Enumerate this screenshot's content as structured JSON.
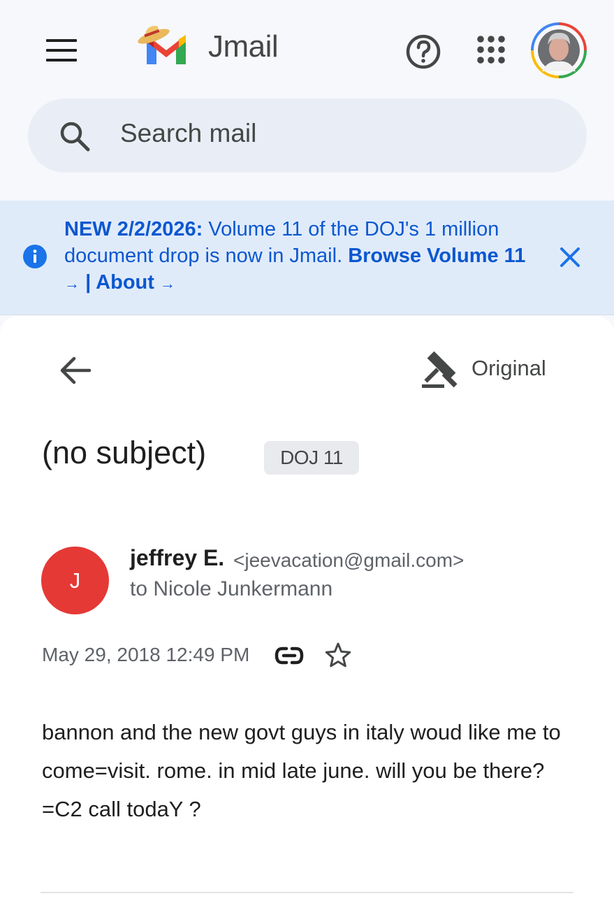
{
  "app": {
    "name": "Jmail"
  },
  "search": {
    "placeholder": "Search mail"
  },
  "banner": {
    "prefix": "NEW 2/2/2026:",
    "message": "Volume 11 of the DOJ's 1 million document drop is now in Jmail.",
    "browse_label": "Browse Volume 11",
    "arrow": "→",
    "separator": "|",
    "about_label": "About"
  },
  "toolbar": {
    "original_label": "Original"
  },
  "email": {
    "subject": "(no subject)",
    "label": "DOJ 11",
    "sender_initial": "J",
    "sender_name": "jeffrey E.",
    "sender_email": "<jeevacation@gmail.com>",
    "recipient": "to Nicole Junkermann",
    "timestamp": "May 29, 2018 12:49 PM",
    "body": "bannon and the new govt guys in italy woud like me to come=visit. rome. in mid late june. will you be there?=C2 call todaY ?"
  },
  "colors": {
    "accent_blue": "#0b57d0",
    "banner_bg": "#e0ebfa",
    "avatar_red": "#e53935",
    "search_bg": "#e9eef6"
  },
  "icons": {
    "menu": "hamburger-menu-icon",
    "help": "help-circle-icon",
    "apps": "apps-grid-icon",
    "search": "search-icon",
    "info": "info-icon",
    "close": "close-icon",
    "back": "arrow-back-icon",
    "original": "gavel-icon",
    "link": "link-icon",
    "star": "star-outline-icon"
  }
}
